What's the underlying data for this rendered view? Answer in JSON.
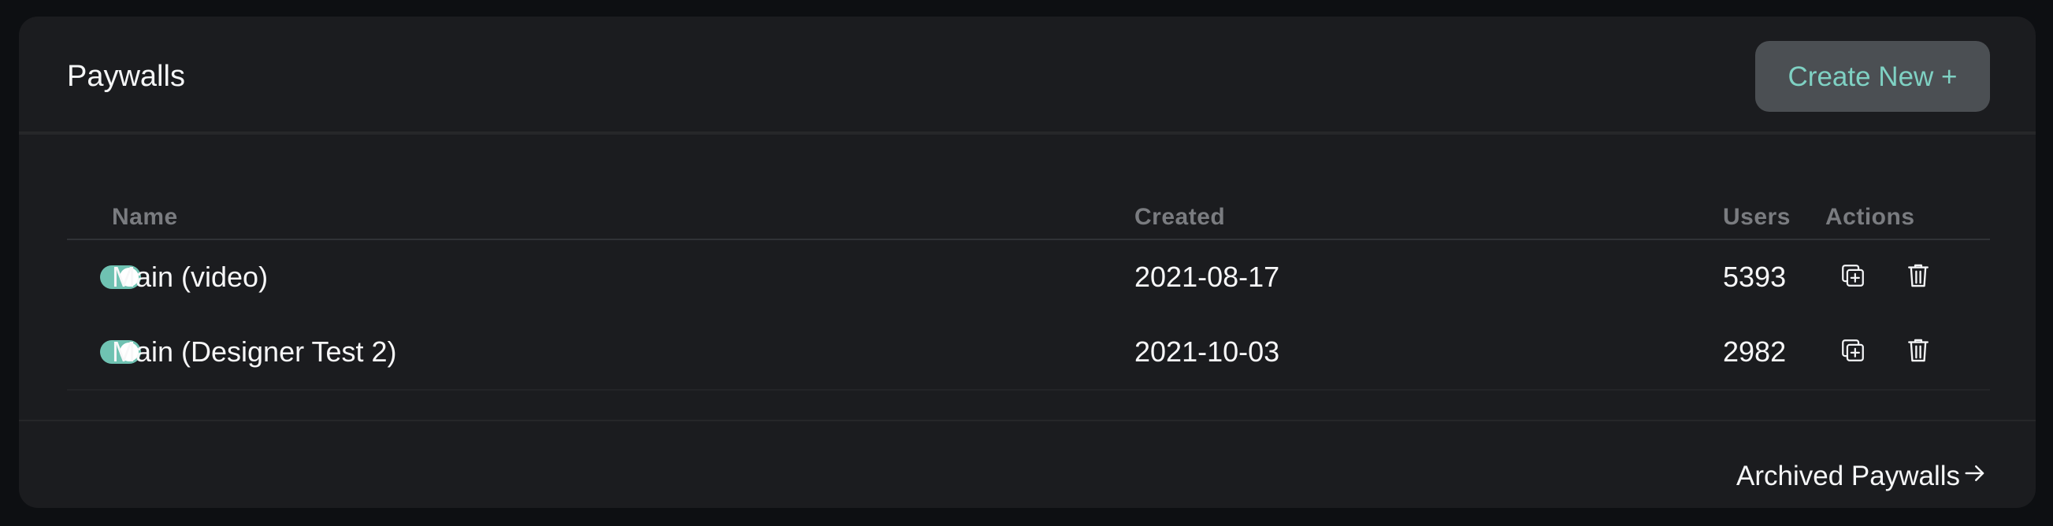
{
  "header": {
    "title": "Paywalls",
    "create_button_label": "Create New +"
  },
  "table": {
    "columns": {
      "name": "Name",
      "created": "Created",
      "users": "Users",
      "actions": "Actions"
    },
    "rows": [
      {
        "enabled": true,
        "name": "Main (video)",
        "created": "2021-08-17",
        "users": "5393"
      },
      {
        "enabled": true,
        "name": "Main (Designer Test 2)",
        "created": "2021-10-03",
        "users": "2982"
      }
    ]
  },
  "footer": {
    "archived_link_label": "Archived Paywalls"
  },
  "colors": {
    "accent": "#7fd1c3",
    "toggle_on": "#6fc2b2",
    "card_bg": "#1b1c1f",
    "page_bg": "#0d0f12"
  },
  "icons": [
    "duplicate-icon",
    "trash-icon",
    "arrow-right-icon"
  ]
}
